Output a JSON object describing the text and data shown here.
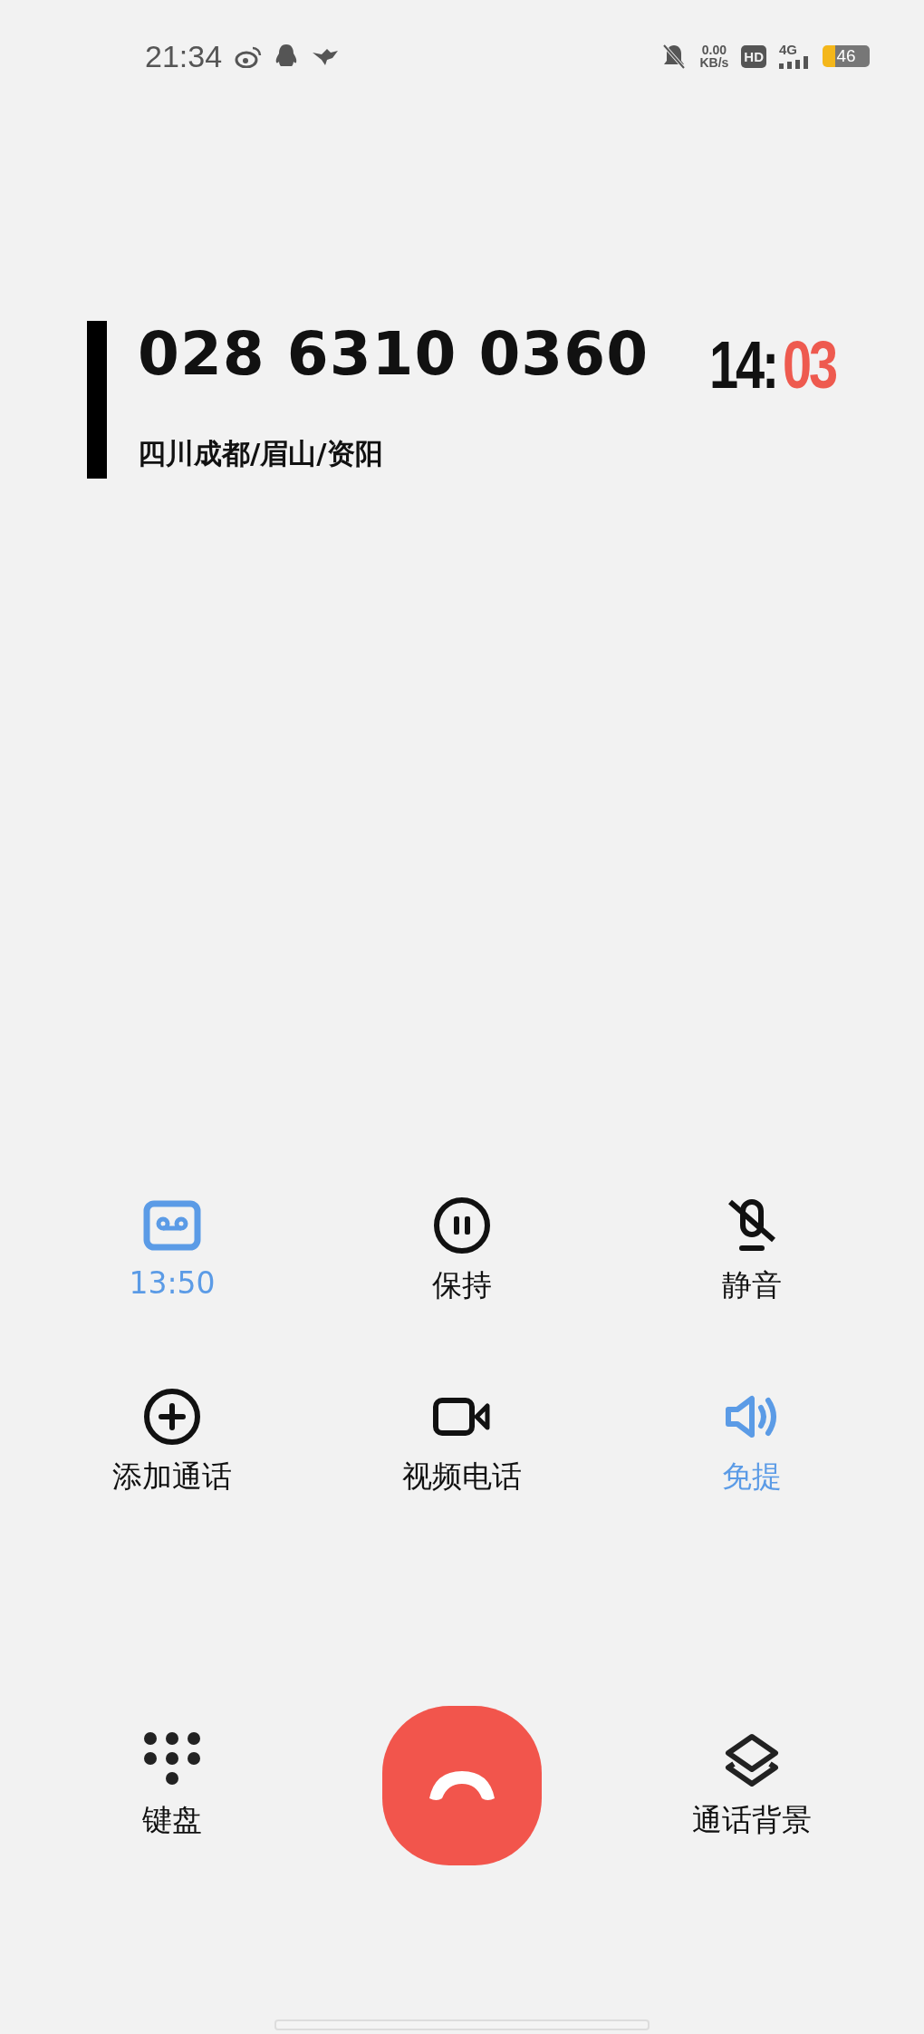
{
  "status_bar": {
    "time": "21:34",
    "speed_value": "0.00",
    "speed_unit": "KB/s",
    "hd": "HD",
    "network": "4G",
    "battery": "46"
  },
  "caller": {
    "number": "028 6310 0360",
    "location": "四川成都/眉山/资阳",
    "timer_main": "14:",
    "timer_highlight": "03"
  },
  "controls": [
    {
      "kind": "record",
      "label": "13:50",
      "active": true
    },
    {
      "kind": "hold",
      "label": "保持",
      "active": false
    },
    {
      "kind": "mute",
      "label": "静音",
      "active": false
    },
    {
      "kind": "add",
      "label": "添加通话",
      "active": false
    },
    {
      "kind": "video",
      "label": "视频电话",
      "active": false
    },
    {
      "kind": "speaker",
      "label": "免提",
      "active": true
    }
  ],
  "bottom": [
    {
      "kind": "keypad",
      "label": "键盘"
    },
    {
      "kind": "hangup"
    },
    {
      "kind": "layers",
      "label": "通话背景"
    }
  ]
}
